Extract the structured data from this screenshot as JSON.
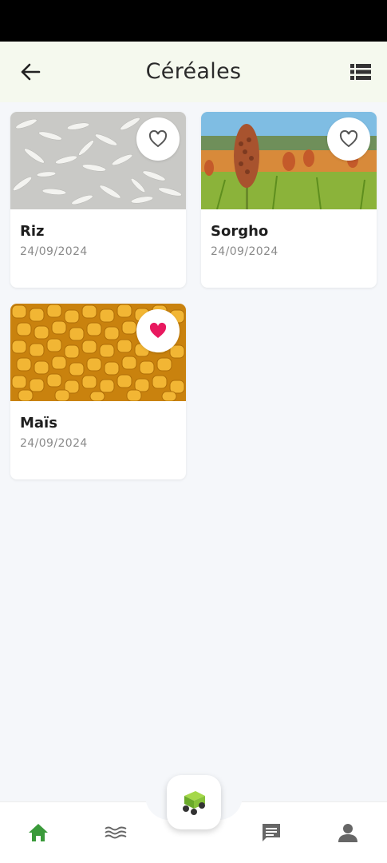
{
  "header": {
    "title": "Céréales",
    "back_icon": "arrow-left-icon",
    "list_icon": "view-list-icon"
  },
  "cards": [
    {
      "name": "Riz",
      "date": "24/09/2024",
      "favorite": false,
      "image": "rice-grains"
    },
    {
      "name": "Sorgho",
      "date": "24/09/2024",
      "favorite": false,
      "image": "sorghum-field"
    },
    {
      "name": "Maïs",
      "date": "24/09/2024",
      "favorite": true,
      "image": "corn-kernels"
    }
  ],
  "bottom_nav": {
    "items": [
      {
        "icon": "home-icon",
        "active": true
      },
      {
        "icon": "waves-icon",
        "active": false
      },
      {
        "icon": "tractor-icon",
        "active": false
      },
      {
        "icon": "chat-icon",
        "active": false
      },
      {
        "icon": "person-icon",
        "active": false
      }
    ]
  },
  "colors": {
    "accent": "#3a9a3a",
    "favorite": "#e8195f",
    "appbar_bg": "#f5f9ee",
    "page_bg": "#f5f7fa"
  }
}
